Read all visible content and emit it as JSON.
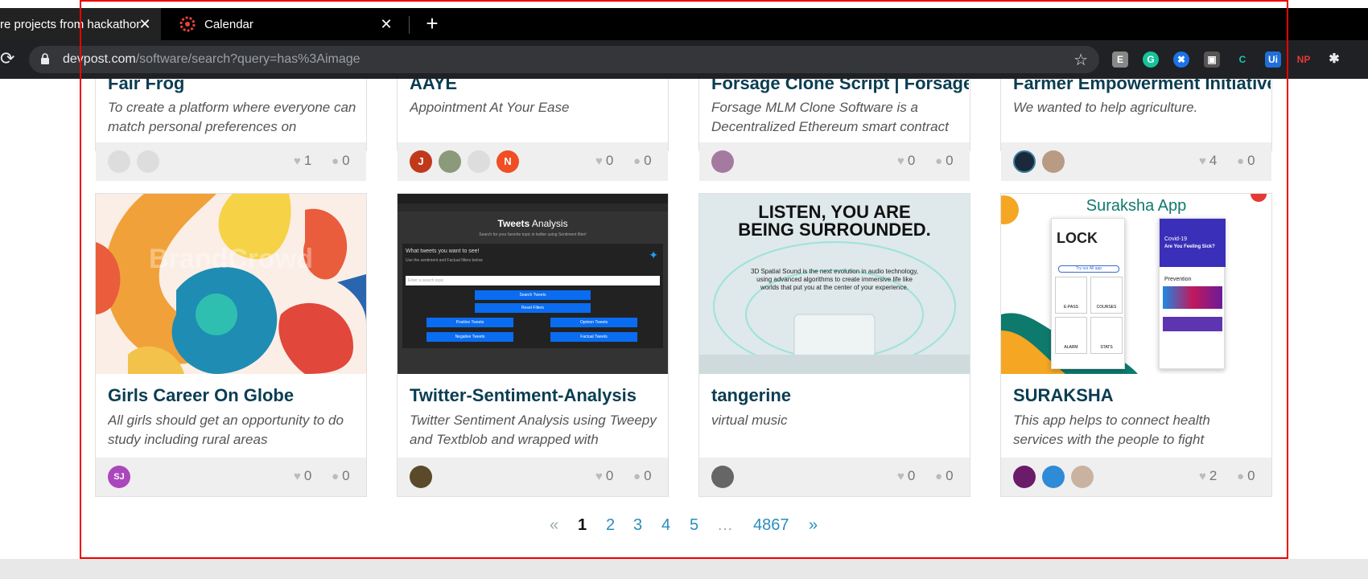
{
  "browser": {
    "tabs": [
      {
        "title": "re projects from hackathon",
        "active": true
      },
      {
        "title": "Calendar",
        "active": false
      }
    ],
    "new_tab": "+",
    "url_domain": "devpost.com",
    "url_path": "/software/search?query=has%3Aimage",
    "extensions": [
      "E",
      "G",
      "✖",
      "▣",
      "C",
      "Ui",
      "NP",
      "✱"
    ]
  },
  "top_cards": [
    {
      "title": "Fair Frog",
      "description": "To create a platform where everyone can match personal preferences on",
      "likes": "1",
      "comments": "0",
      "avatars": [
        {
          "label": "",
          "color": "#ddd"
        },
        {
          "label": "",
          "color": "#ddd"
        }
      ]
    },
    {
      "title": "AAYE",
      "description": "Appointment At Your Ease",
      "likes": "0",
      "comments": "0",
      "avatars": [
        {
          "label": "J",
          "color": "#c0391b"
        },
        {
          "label": "",
          "color": "#8a9a7a"
        },
        {
          "label": "",
          "color": "#ddd"
        },
        {
          "label": "N",
          "color": "#f04e23"
        }
      ]
    },
    {
      "title": "Forsage Clone Script | Forsage",
      "description": "Forsage MLM Clone Software is a Decentralized Ethereum smart contract",
      "likes": "0",
      "comments": "0",
      "avatars": [
        {
          "label": "",
          "color": "#a57aa0"
        }
      ]
    },
    {
      "title": "Farmer Empowerment Initiative",
      "description": "We wanted to help agriculture.",
      "likes": "4",
      "comments": "0",
      "avatars": [
        {
          "label": "",
          "color": "#1a2a3a"
        },
        {
          "label": "",
          "color": "#b99a84"
        }
      ]
    }
  ],
  "bottom_cards": [
    {
      "title": "Girls Career On Globe",
      "description": "All girls should get an opportunity to do study including rural areas",
      "likes": "0",
      "comments": "0",
      "avatars": [
        {
          "label": "SJ",
          "color": "#ab47bc"
        }
      ],
      "image": "brandcrowd-logo",
      "watermark": "BrandCrowd"
    },
    {
      "title": "Twitter-Sentiment-Analysis",
      "description": "Twitter Sentiment Analysis using Tweepy and Textblob and wrapped with",
      "likes": "0",
      "comments": "0",
      "avatars": [
        {
          "label": "",
          "color": "#5a4a2a"
        }
      ],
      "image": "tweets-analysis-screenshot",
      "shot": {
        "title_bold": "Tweets",
        "title_rest": " Analysis",
        "subtitle": "Search for your favorite topic in twitter using Sentiment filter!",
        "question": "What tweets you want to see!",
        "hint": "Use the sentiment and Factual filters below",
        "input_placeholder": "Enter a search topic",
        "buttons": [
          "Search Tweets",
          "Reset Filters",
          "Positive Tweets",
          "Opinion Tweets",
          "Negative Tweets",
          "Factual Tweets"
        ]
      }
    },
    {
      "title": "tangerine",
      "description": "virtual music",
      "likes": "0",
      "comments": "0",
      "avatars": [
        {
          "label": "",
          "color": "#666"
        }
      ],
      "image": "listen-surround-ad",
      "ad": {
        "headline": "LISTEN, YOU ARE BEING SURROUNDED.",
        "body": "3D Spatial Sound is the next evolution in audio technology, using advanced algorithms to create immersive life like worlds that put you at the center of your experience."
      }
    },
    {
      "title": "SURAKSHA",
      "description": "This app helps to connect health services with the people to fight",
      "likes": "2",
      "comments": "0",
      "avatars": [
        {
          "label": "",
          "color": "#6a1b6a"
        },
        {
          "label": "",
          "color": "#2e8bd8"
        },
        {
          "label": "",
          "color": "#c9b3a0"
        }
      ],
      "image": "suraksha-app-mock",
      "app": {
        "name": "Suraksha App",
        "lock": "LOCK",
        "try_all": "Try our All app",
        "tiles": [
          "E-PASS",
          "COURSES",
          "ALARM",
          "STATS"
        ],
        "covid": "Covid-19",
        "sick": "Are You Feeling Sick?",
        "prevention": "Prevention"
      }
    }
  ],
  "pagination": {
    "prev": "«",
    "pages": [
      "1",
      "2",
      "3",
      "4",
      "5"
    ],
    "current": "1",
    "ellipsis": "…",
    "last": "4867",
    "next": "»"
  },
  "colors": {
    "title": "#0a3d52",
    "link": "#2a8dbf",
    "highlight_border": "#e00000"
  }
}
